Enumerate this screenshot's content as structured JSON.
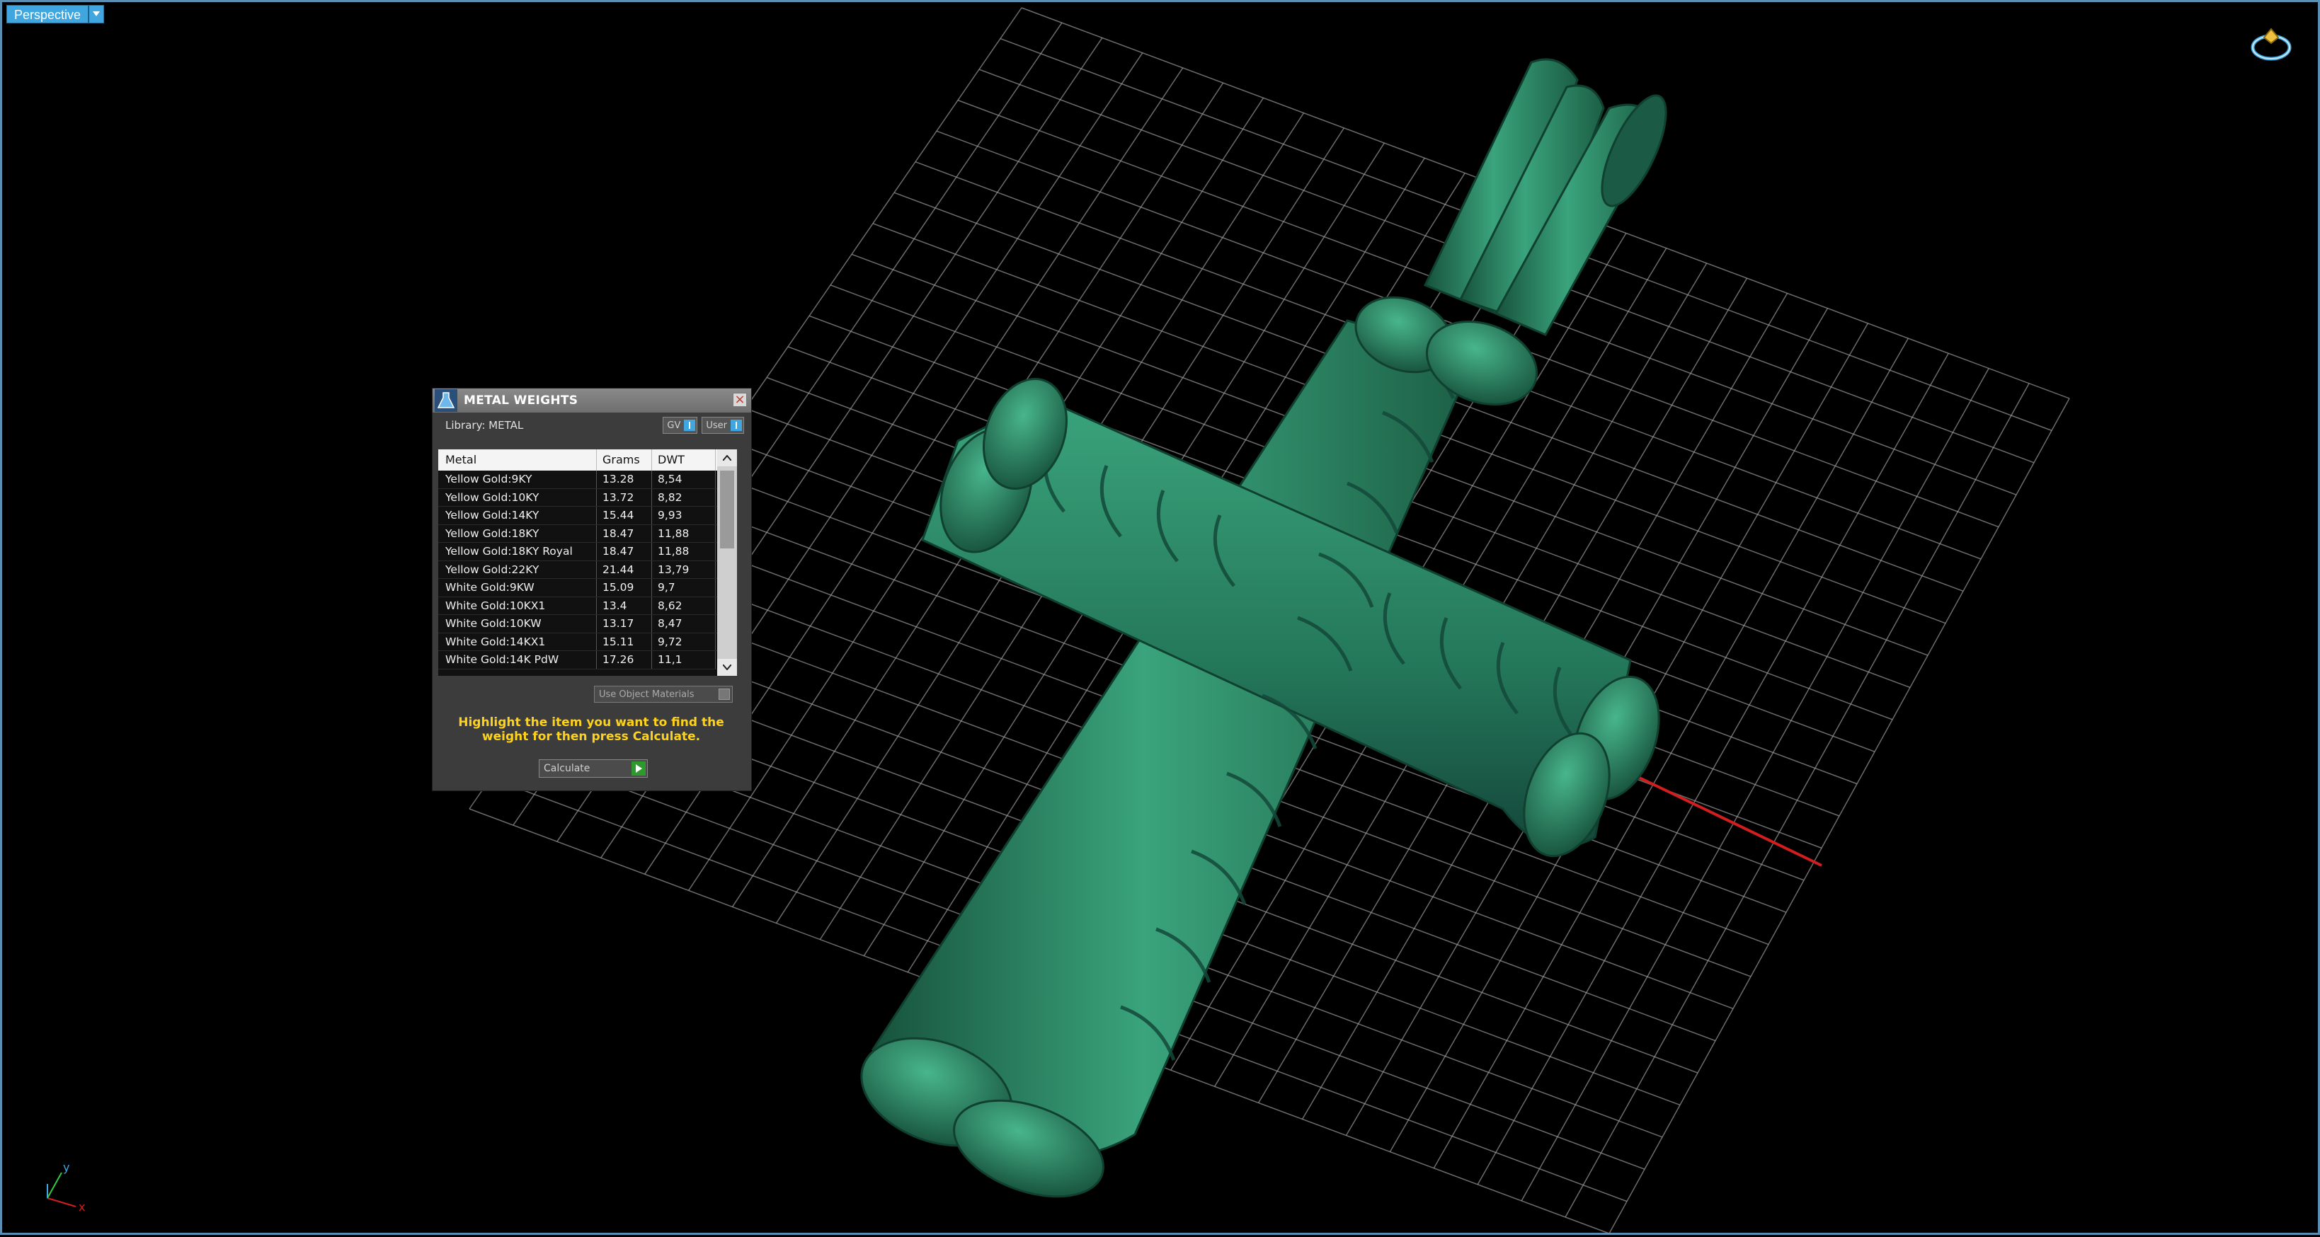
{
  "viewport": {
    "label": "Perspective"
  },
  "panel": {
    "title": "METAL WEIGHTS",
    "library_label": "Library: METAL",
    "toggle_gv": "GV",
    "toggle_user": "User",
    "columns": [
      "Metal",
      "Grams",
      "DWT"
    ],
    "rows": [
      {
        "metal": "Yellow Gold:9KY",
        "grams": "13.28",
        "dwt": "8,54"
      },
      {
        "metal": "Yellow Gold:10KY",
        "grams": "13.72",
        "dwt": "8,82"
      },
      {
        "metal": "Yellow Gold:14KY",
        "grams": "15.44",
        "dwt": "9,93"
      },
      {
        "metal": "Yellow Gold:18KY",
        "grams": "18.47",
        "dwt": "11,88"
      },
      {
        "metal": "Yellow Gold:18KY Royal",
        "grams": "18.47",
        "dwt": "11,88"
      },
      {
        "metal": "Yellow Gold:22KY",
        "grams": "21.44",
        "dwt": "13,79"
      },
      {
        "metal": "White Gold:9KW",
        "grams": "15.09",
        "dwt": "9,7"
      },
      {
        "metal": "White Gold:10KX1",
        "grams": "13.4",
        "dwt": "8,62"
      },
      {
        "metal": "White Gold:10KW",
        "grams": "13.17",
        "dwt": "8,47"
      },
      {
        "metal": "White Gold:14KX1",
        "grams": "15.11",
        "dwt": "9,72"
      },
      {
        "metal": "White Gold:14K PdW",
        "grams": "17.26",
        "dwt": "11,1"
      }
    ],
    "use_object_materials": "Use Object Materials",
    "hint": "Highlight the item you want to find the weight for then press Calculate.",
    "calculate_label": "Calculate"
  },
  "colors": {
    "model": "#2f8a67",
    "grid": "#9a9a9a",
    "axis_x": "#d21e1e",
    "accent": "#3fa6e0",
    "hint": "#ffd21a"
  },
  "gizmo": {
    "x_label": "x",
    "y_label": "y"
  }
}
